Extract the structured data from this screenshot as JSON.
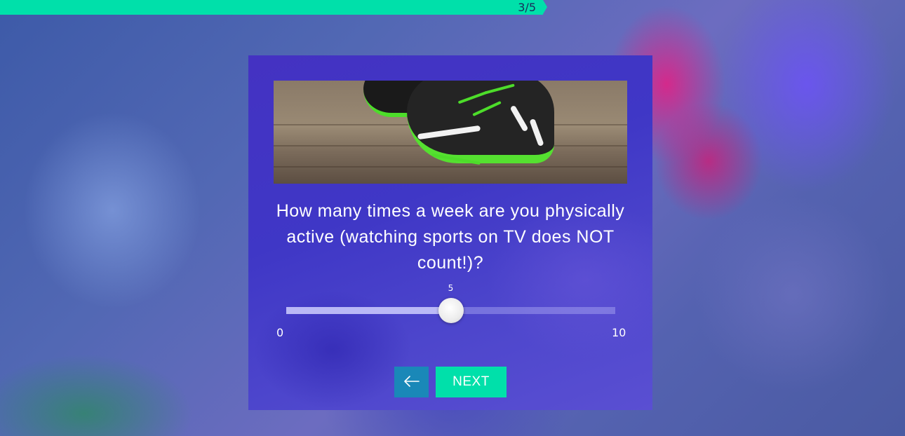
{
  "progress": {
    "label": "3/5",
    "current": 3,
    "total": 5,
    "fraction": 0.6,
    "color": "#00e0aa"
  },
  "card": {
    "question": "How many times a week are you physically active (watching sports on TV does NOT count!)?",
    "hero_image": "running-shoe-image",
    "slider": {
      "min": 0,
      "max": 10,
      "value": 5,
      "min_label": "0",
      "max_label": "10",
      "value_label": "5"
    },
    "back_icon": "arrow-left-icon",
    "next_label": "NEXT"
  },
  "colors": {
    "accent": "#00e0aa",
    "back_button": "#1a88b8",
    "card": "#4432c2"
  }
}
